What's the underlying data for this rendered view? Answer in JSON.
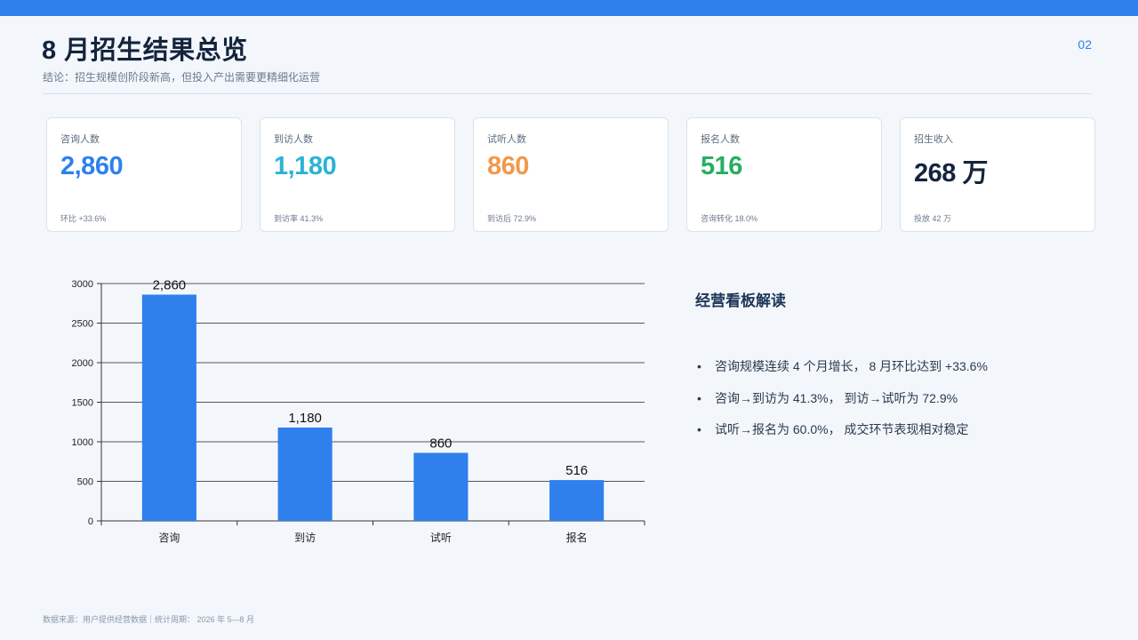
{
  "header": {
    "title": "8 月招生结果总览",
    "page_number": "02",
    "subtitle": "结论：招生规模创阶段新高，但投入产出需要更精细化运营"
  },
  "kpis": [
    {
      "label": "咨询人数",
      "value": "2,860",
      "note": "环比 +33.6%",
      "color": "#2f80ed"
    },
    {
      "label": "到访人数",
      "value": "1,180",
      "note": "到访率 41.3%",
      "color": "#2bb3d4"
    },
    {
      "label": "试听人数",
      "value": "860",
      "note": "到访后 72.9%",
      "color": "#f2994a"
    },
    {
      "label": "报名人数",
      "value": "516",
      "note": "咨询转化 18.0%",
      "color": "#27ae60"
    },
    {
      "label": "招生收入",
      "value": "268 万",
      "note": "投放 42 万",
      "color": "#14243d"
    }
  ],
  "chart_data": {
    "type": "bar",
    "title": "",
    "xlabel": "",
    "ylabel": "",
    "categories": [
      "咨询",
      "到访",
      "试听",
      "报名"
    ],
    "values": [
      2860,
      1180,
      860,
      516
    ],
    "data_labels": [
      "2,860",
      "1,180",
      "860",
      "516"
    ],
    "ylim": [
      0,
      3000
    ],
    "yticks": [
      0,
      500,
      1000,
      1500,
      2000,
      2500,
      3000
    ],
    "grid": true,
    "bar_color": "#2f80ed"
  },
  "side_panel": {
    "title": "经营看板解读",
    "bullets": [
      "咨询规模连续 4 个月增长， 8 月环比达到 +33.6%",
      "咨询→到访为  41.3%， 到访→试听为  72.9%",
      "试听→报名为  60.0%， 成交环节表现相对稳定"
    ],
    "bullet_mark": "•"
  },
  "footer": {
    "text": "数据来源：用户提供经营数据｜统计周期： 2026 年 5—8 月"
  }
}
